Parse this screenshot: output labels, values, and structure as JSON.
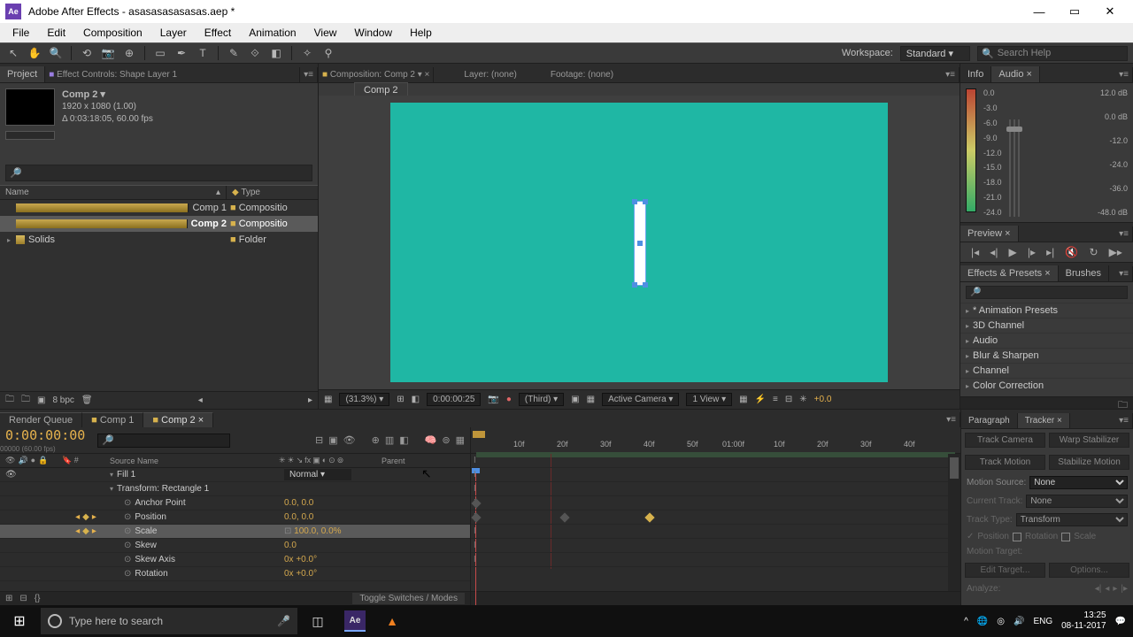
{
  "window": {
    "app_icon": "Ae",
    "title": "Adobe After Effects - asasasasasasas.aep *"
  },
  "menu": [
    "File",
    "Edit",
    "Composition",
    "Layer",
    "Effect",
    "Animation",
    "View",
    "Window",
    "Help"
  ],
  "workspace": {
    "label": "Workspace:",
    "value": "Standard"
  },
  "search_help_placeholder": "Search Help",
  "project": {
    "tab_project": "Project",
    "tab_effect_controls": "Effect Controls: Shape Layer 1",
    "comp_name": "Comp 2 ▾",
    "resolution": "1920 x 1080 (1.00)",
    "duration": "Δ 0:03:18:05, 60.00 fps",
    "col_name": "Name",
    "col_type": "Type",
    "items": [
      {
        "name": "Comp 1",
        "type": "Compositio",
        "kind": "comp"
      },
      {
        "name": "Comp 2",
        "type": "Compositio",
        "kind": "comp",
        "selected": true
      },
      {
        "name": "Solids",
        "type": "Folder",
        "kind": "folder"
      }
    ],
    "bpc": "8 bpc"
  },
  "composition": {
    "tab_label": "Composition: Comp 2",
    "layer_tab": "Layer: (none)",
    "footage_tab": "Footage: (none)",
    "inner_tab": "Comp 2",
    "zoom": "(31.3%)",
    "time": "0:00:00:25",
    "quality": "(Third)",
    "camera": "Active Camera",
    "views": "1 View",
    "exposure": "+0.0"
  },
  "info": {
    "tab_info": "Info",
    "tab_audio": "Audio",
    "left_scale": [
      "0.0",
      "-3.0",
      "-6.0",
      "-9.0",
      "-12.0",
      "-15.0",
      "-18.0",
      "-21.0",
      "-24.0"
    ],
    "right_scale": [
      "12.0 dB",
      "0.0 dB",
      "-12.0",
      "-24.0",
      "-36.0",
      "-48.0 dB"
    ]
  },
  "preview": {
    "tab": "Preview"
  },
  "effects": {
    "tab_fx": "Effects & Presets",
    "tab_brushes": "Brushes",
    "items": [
      "* Animation Presets",
      "3D Channel",
      "Audio",
      "Blur & Sharpen",
      "Channel",
      "Color Correction"
    ]
  },
  "timeline": {
    "tab_render": "Render Queue",
    "tab_comp1": "Comp 1",
    "tab_comp2": "Comp 2",
    "timecode": "0:00:00:00",
    "tc_sub": "00000 (60.00 fps)",
    "col_num": "#",
    "col_source": "Source Name",
    "col_parent": "Parent",
    "rows": [
      {
        "label": "Fill 1",
        "mode": "Normal",
        "indent": 0,
        "twirl": "▾"
      },
      {
        "label": "Transform: Rectangle 1",
        "indent": 0,
        "twirl": "▾"
      },
      {
        "label": "Anchor Point",
        "value": "0.0, 0.0",
        "indent": 1,
        "clock": true
      },
      {
        "label": "Position",
        "value": "0.0, 0.0",
        "indent": 1,
        "clock": true,
        "key": true
      },
      {
        "label": "Scale",
        "value": "100.0, 0.0%",
        "indent": 1,
        "clock": true,
        "key": true,
        "selected": true,
        "link": true
      },
      {
        "label": "Skew",
        "value": "0.0",
        "indent": 1,
        "clock": true
      },
      {
        "label": "Skew Axis",
        "value": "0x +0.0°",
        "indent": 1,
        "clock": true
      },
      {
        "label": "Rotation",
        "value": "0x +0.0°",
        "indent": 1,
        "clock": true
      }
    ],
    "ruler": [
      "10f",
      "20f",
      "30f",
      "40f",
      "50f",
      "01:00f",
      "10f",
      "20f",
      "30f",
      "40f"
    ],
    "toggle_switches": "Toggle Switches / Modes"
  },
  "tracker": {
    "tab_paragraph": "Paragraph",
    "tab_tracker": "Tracker",
    "track_camera": "Track Camera",
    "warp_stab": "Warp Stabilizer",
    "track_motion": "Track Motion",
    "stab_motion": "Stabilize Motion",
    "motion_source_lbl": "Motion Source:",
    "motion_source_val": "None",
    "current_track_lbl": "Current Track:",
    "current_track_val": "None",
    "track_type_lbl": "Track Type:",
    "track_type_val": "Transform",
    "cb_position": "Position",
    "cb_rotation": "Rotation",
    "cb_scale": "Scale",
    "motion_target": "Motion Target:",
    "edit_target": "Edit Target...",
    "options": "Options...",
    "analyze": "Analyze:"
  },
  "taskbar": {
    "search_placeholder": "Type here to search",
    "lang": "ENG",
    "time": "13:25",
    "date": "08-11-2017"
  }
}
